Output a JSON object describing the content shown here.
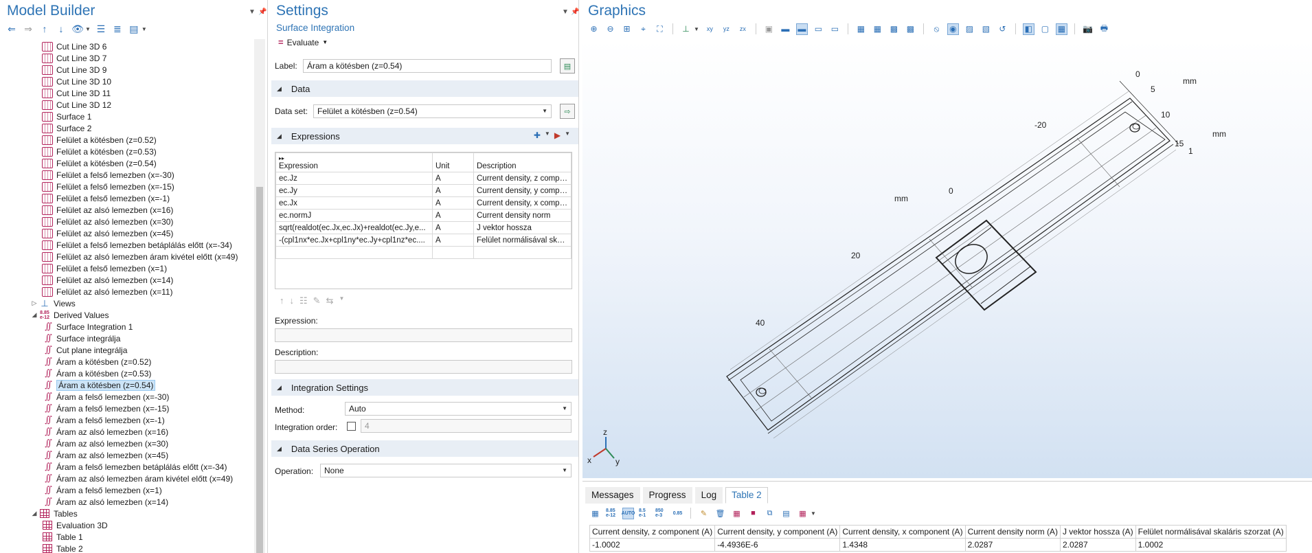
{
  "model_builder": {
    "title": "Model Builder",
    "tree": [
      {
        "label": "Cut Line 3D 6",
        "icon": "cut-line-icon",
        "indent": 2
      },
      {
        "label": "Cut Line 3D 7",
        "icon": "cut-line-icon",
        "indent": 2
      },
      {
        "label": "Cut Line 3D 9",
        "icon": "cut-line-icon",
        "indent": 2
      },
      {
        "label": "Cut Line 3D 10",
        "icon": "cut-line-icon",
        "indent": 2
      },
      {
        "label": "Cut Line 3D 11",
        "icon": "cut-line-icon",
        "indent": 2
      },
      {
        "label": "Cut Line 3D 12",
        "icon": "cut-line-icon",
        "indent": 2
      },
      {
        "label": "Surface 1",
        "icon": "surface-icon",
        "indent": 2
      },
      {
        "label": "Surface 2",
        "icon": "surface-icon",
        "indent": 2
      },
      {
        "label": "Felület a kötésben (z=0.52)",
        "icon": "cut-plane-icon",
        "indent": 2
      },
      {
        "label": "Felület a kötésben (z=0.53)",
        "icon": "cut-plane-icon",
        "indent": 2
      },
      {
        "label": "Felület a kötésben (z=0.54)",
        "icon": "cut-plane-icon",
        "indent": 2
      },
      {
        "label": "Felület a felső lemezben (x=-30)",
        "icon": "cut-plane-icon",
        "indent": 2
      },
      {
        "label": "Felület a felső lemezben (x=-15)",
        "icon": "cut-plane-icon",
        "indent": 2
      },
      {
        "label": "Felület a felső lemezben (x=-1)",
        "icon": "cut-plane-icon",
        "indent": 2
      },
      {
        "label": "Felület az alsó lemezben (x=16)",
        "icon": "cut-plane-icon",
        "indent": 2
      },
      {
        "label": "Felület az alsó lemezben (x=30)",
        "icon": "cut-plane-icon",
        "indent": 2
      },
      {
        "label": "Felület az alsó lemezben (x=45)",
        "icon": "cut-plane-icon",
        "indent": 2
      },
      {
        "label": "Felület a felső lemezben betáplálás előtt (x=-34)",
        "icon": "cut-plane-icon",
        "indent": 2
      },
      {
        "label": "Felület az alsó lemezben áram kivétel előtt (x=49)",
        "icon": "cut-plane-icon",
        "indent": 2
      },
      {
        "label": "Felület a felső lemezben (x=1)",
        "icon": "cut-plane-icon",
        "indent": 2
      },
      {
        "label": "Felület az alsó lemezben (x=14)",
        "icon": "cut-plane-icon",
        "indent": 2
      },
      {
        "label": "Felület az alsó lemezben (x=11)",
        "icon": "cut-plane-icon",
        "indent": 2
      },
      {
        "label": "Views",
        "icon": "views-icon",
        "indent": 1,
        "expander": "▷"
      },
      {
        "label": "Derived Values",
        "icon": "derived-values-icon",
        "indent": 1,
        "expander": "◢"
      },
      {
        "label": "Surface Integration 1",
        "icon": "integral-icon",
        "indent": 2
      },
      {
        "label": "Surface integrálja",
        "icon": "integral-icon",
        "indent": 2
      },
      {
        "label": "Cut plane integrálja",
        "icon": "integral-icon",
        "indent": 2
      },
      {
        "label": "Áram a kötésben (z=0.52)",
        "icon": "integral-icon",
        "indent": 2
      },
      {
        "label": "Áram a kötésben (z=0.53)",
        "icon": "integral-icon",
        "indent": 2
      },
      {
        "label": "Áram a kötésben (z=0.54)",
        "icon": "integral-icon",
        "indent": 2,
        "selected": true
      },
      {
        "label": "Áram a felső lemezben (x=-30)",
        "icon": "integral-icon",
        "indent": 2
      },
      {
        "label": "Áram a felső lemezben (x=-15)",
        "icon": "integral-icon",
        "indent": 2
      },
      {
        "label": "Áram a felső lemezben (x=-1)",
        "icon": "integral-icon",
        "indent": 2
      },
      {
        "label": "Áram az alsó lemezben (x=16)",
        "icon": "integral-icon",
        "indent": 2
      },
      {
        "label": "Áram az alsó lemezben (x=30)",
        "icon": "integral-icon",
        "indent": 2
      },
      {
        "label": "Áram az alsó lemezben (x=45)",
        "icon": "integral-icon",
        "indent": 2
      },
      {
        "label": "Áram a felső lemezben betáplálás előtt (x=-34)",
        "icon": "integral-icon",
        "indent": 2
      },
      {
        "label": "Áram az alsó lemezben áram kivétel előtt (x=49)",
        "icon": "integral-icon",
        "indent": 2
      },
      {
        "label": "Áram a felső lemezben (x=1)",
        "icon": "integral-icon",
        "indent": 2
      },
      {
        "label": "Áram az alsó lemezben (x=14)",
        "icon": "integral-icon",
        "indent": 2
      },
      {
        "label": "Tables",
        "icon": "table-icon",
        "indent": 1,
        "expander": "◢"
      },
      {
        "label": "Evaluation 3D",
        "icon": "table-icon",
        "indent": 2
      },
      {
        "label": "Table 1",
        "icon": "table-icon",
        "indent": 2
      },
      {
        "label": "Table 2",
        "icon": "table-icon",
        "indent": 2
      }
    ]
  },
  "settings": {
    "title": "Settings",
    "subtitle": "Surface Integration",
    "evaluate_label": "Evaluate",
    "label_caption": "Label:",
    "label_value": "Áram a kötésben (z=0.54)",
    "data_section": "Data",
    "dataset_caption": "Data set:",
    "dataset_value": "Felület a kötésben (z=0.54)",
    "expressions_section": "Expressions",
    "expr_headers": [
      "Expression",
      "Unit",
      "Description"
    ],
    "expr_rows": [
      [
        "ec.Jz",
        "A",
        "Current density, z compo..."
      ],
      [
        "ec.Jy",
        "A",
        "Current density, y compo..."
      ],
      [
        "ec.Jx",
        "A",
        "Current density, x compo..."
      ],
      [
        "ec.normJ",
        "A",
        "Current density norm"
      ],
      [
        "sqrt(realdot(ec.Jx,ec.Jx)+realdot(ec.Jy,e...",
        "A",
        "J vektor hossza"
      ],
      [
        "-(cpl1nx*ec.Jx+cpl1ny*ec.Jy+cpl1nz*ec....",
        "A",
        "Felület normálisával skalá..."
      ],
      [
        "",
        "",
        ""
      ]
    ],
    "expression_caption": "Expression:",
    "description_caption": "Description:",
    "integration_section": "Integration Settings",
    "method_caption": "Method:",
    "method_value": "Auto",
    "order_caption": "Integration order:",
    "order_value": "4",
    "dataseries_section": "Data Series Operation",
    "operation_caption": "Operation:",
    "operation_value": "None"
  },
  "graphics": {
    "title": "Graphics",
    "axis_labels": {
      "top_0": "0",
      "top_5": "5",
      "top_10": "10",
      "top_15": "15",
      "top_mm": "mm",
      "right_1": "1",
      "right_mm": "mm",
      "x_m20": "-20",
      "x_0": "0",
      "x_20": "20",
      "x_40": "40",
      "x_mm": "mm"
    },
    "triad": {
      "x": "x",
      "y": "y",
      "z": "z"
    }
  },
  "bottom": {
    "tabs": [
      "Messages",
      "Progress",
      "Log",
      "Table 2"
    ],
    "active_tab": "Table 2",
    "toolbar_texts": {
      "fmt1": "8.85 e-12",
      "auto": "AUTO",
      "fmt2": "8.5 e-1",
      "fmt3": "850 e-3",
      "fmt4": "0.85"
    },
    "headers": [
      "Current density, z component (A)",
      "Current density, y component (A)",
      "Current density, x component (A)",
      "Current density norm (A)",
      "J vektor hossza (A)",
      "Felület normálisával skaláris szorzat (A)"
    ],
    "row": [
      "-1.0002",
      "-4.4936E-6",
      "1.4348",
      "2.0287",
      "2.0287",
      "1.0002"
    ]
  },
  "colors": {
    "accent": "#2e74b5",
    "icon_magenta": "#b2215a",
    "section_bg": "#e8eef5",
    "selection": "#cce4f7"
  }
}
